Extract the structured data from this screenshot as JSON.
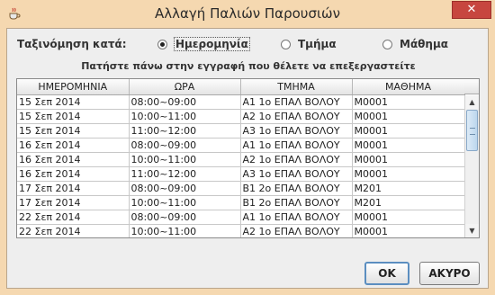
{
  "window": {
    "title": "Αλλαγή Παλιών Παρουσιών",
    "close_label": "✕"
  },
  "sort": {
    "label": "Ταξινόμηση κατά:",
    "options": [
      {
        "label": "Ημερομηνία",
        "selected": true
      },
      {
        "label": "Τμήμα",
        "selected": false
      },
      {
        "label": "Μάθημα",
        "selected": false
      }
    ]
  },
  "instruction": "Πατήστε πάνω στην εγγραφή που θέλετε να επεξεργαστείτε",
  "table": {
    "columns": [
      "ΗΜΕΡΟΜΗΝΙΑ",
      "ΩΡΑ",
      "ΤΜΗΜΑ",
      "ΜΑΘΗΜΑ"
    ],
    "rows": [
      [
        "15 Σεπ 2014",
        "08:00~09:00",
        "Α1 1ο ΕΠΑΛ ΒΟΛΟΥ",
        "Μ0001"
      ],
      [
        "15 Σεπ 2014",
        "10:00~11:00",
        "Α2 1ο ΕΠΑΛ ΒΟΛΟΥ",
        "Μ0001"
      ],
      [
        "15 Σεπ 2014",
        "11:00~12:00",
        "Α3 1ο ΕΠΑΛ ΒΟΛΟΥ",
        "Μ0001"
      ],
      [
        "16 Σεπ 2014",
        "08:00~09:00",
        "Α1 1ο ΕΠΑΛ ΒΟΛΟΥ",
        "Μ0001"
      ],
      [
        "16 Σεπ 2014",
        "10:00~11:00",
        "Α2 1ο ΕΠΑΛ ΒΟΛΟΥ",
        "Μ0001"
      ],
      [
        "16 Σεπ 2014",
        "11:00~12:00",
        "Α3 1ο ΕΠΑΛ ΒΟΛΟΥ",
        "Μ0001"
      ],
      [
        "17 Σεπ 2014",
        "08:00~09:00",
        "Β1 2ο ΕΠΑΛ ΒΟΛΟΥ",
        "Μ201"
      ],
      [
        "17 Σεπ 2014",
        "10:00~11:00",
        "Β1 2ο ΕΠΑΛ ΒΟΛΟΥ",
        "Μ201"
      ],
      [
        "22 Σεπ 2014",
        "08:00~09:00",
        "Α1 1ο ΕΠΑΛ ΒΟΛΟΥ",
        "Μ0001"
      ],
      [
        "22 Σεπ 2014",
        "10:00~11:00",
        "Α2 1ο ΕΠΑΛ ΒΟΛΟΥ",
        "Μ0001"
      ]
    ]
  },
  "buttons": {
    "ok": "OK",
    "cancel": "ΑΚΥΡΟ"
  },
  "icons": {
    "app": "java-cup-icon",
    "close": "close-icon",
    "scroll_up": "arrow-up-icon",
    "scroll_down": "arrow-down-icon"
  },
  "colors": {
    "frame": "#f5d8b0",
    "close": "#c7463f",
    "ok_border": "#5b8ec0"
  }
}
